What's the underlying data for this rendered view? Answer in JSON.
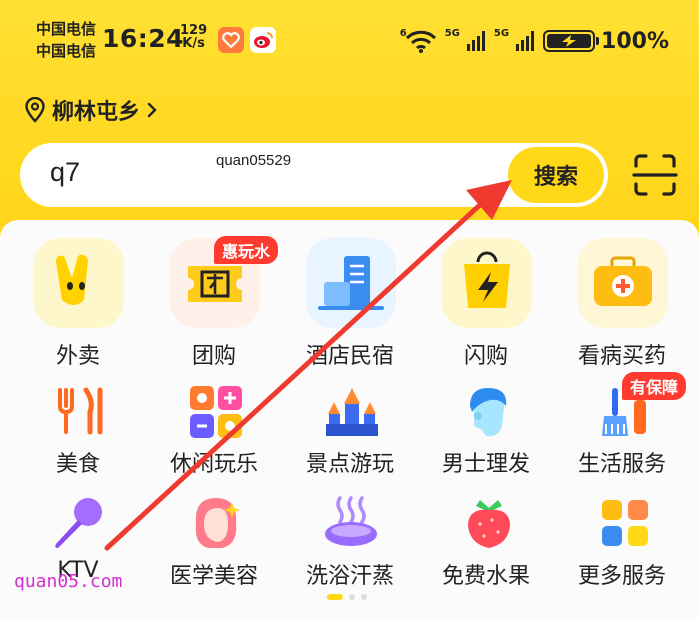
{
  "status_bar": {
    "carrier_1": "中国电信",
    "carrier_2": "中国电信",
    "time": "16:24",
    "net_speed_value": "129",
    "net_speed_unit": "K/s",
    "signal_1": "5G",
    "signal_2": "5G",
    "wifi_label": "6",
    "battery": "100%"
  },
  "location": {
    "label": "柳林屯乡"
  },
  "search": {
    "value": "q7",
    "button_label": "搜索"
  },
  "watermark_top": "quan05529",
  "watermark_bottom": "quan05.com",
  "grid": [
    {
      "label": "外卖",
      "icon": "takeout-icon"
    },
    {
      "label": "团购",
      "icon": "group-buy-icon",
      "badge": "惠玩水"
    },
    {
      "label": "酒店民宿",
      "icon": "hotel-icon"
    },
    {
      "label": "闪购",
      "icon": "flash-buy-icon"
    },
    {
      "label": "看病买药",
      "icon": "medicine-icon"
    },
    {
      "label": "美食",
      "icon": "food-icon"
    },
    {
      "label": "休闲玩乐",
      "icon": "leisure-icon"
    },
    {
      "label": "景点游玩",
      "icon": "attraction-icon"
    },
    {
      "label": "男士理发",
      "icon": "barber-icon"
    },
    {
      "label": "生活服务",
      "icon": "life-service-icon",
      "badge": "有保障"
    },
    {
      "label": "KTV",
      "icon": "ktv-icon"
    },
    {
      "label": "医学美容",
      "icon": "medical-beauty-icon"
    },
    {
      "label": "洗浴汗蒸",
      "icon": "bath-icon"
    },
    {
      "label": "免费水果",
      "icon": "free-fruit-icon"
    },
    {
      "label": "更多服务",
      "icon": "more-services-icon"
    }
  ],
  "colors": {
    "brand_yellow": "#ffd817",
    "badge_red": "#ff3b2f",
    "annotation_red": "#ef3b2f"
  }
}
